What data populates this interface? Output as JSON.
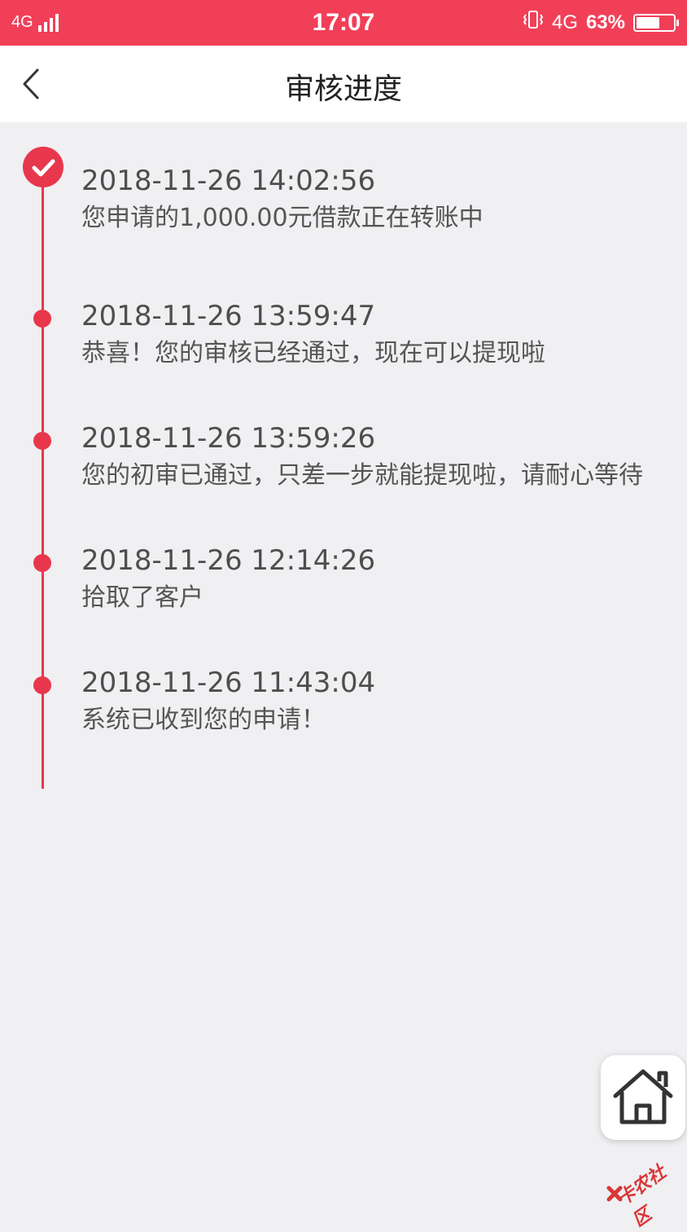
{
  "status_bar": {
    "network_left": "4G",
    "time": "17:07",
    "network_right": "4G",
    "battery_percent": "63%",
    "battery_level": 0.63
  },
  "header": {
    "title": "审核进度",
    "back_icon": "chevron-left-icon"
  },
  "timeline": {
    "accent_color": "#e8374d",
    "entries": [
      {
        "time": "2018-11-26 14:02:56",
        "message": "您申请的1,000.00元借款正在转账中",
        "status": "current"
      },
      {
        "time": "2018-11-26 13:59:47",
        "message": "恭喜！您的审核已经通过，现在可以提现啦",
        "status": "done"
      },
      {
        "time": "2018-11-26 13:59:26",
        "message": "您的初审已通过，只差一步就能提现啦，请耐心等待",
        "status": "done"
      },
      {
        "time": "2018-11-26 12:14:26",
        "message": "拾取了客户",
        "status": "done"
      },
      {
        "time": "2018-11-26 11:43:04",
        "message": "系统已收到您的申请！",
        "status": "done"
      }
    ]
  },
  "home_button": {
    "icon": "home-icon"
  },
  "watermark": {
    "text": "卡农社区"
  }
}
